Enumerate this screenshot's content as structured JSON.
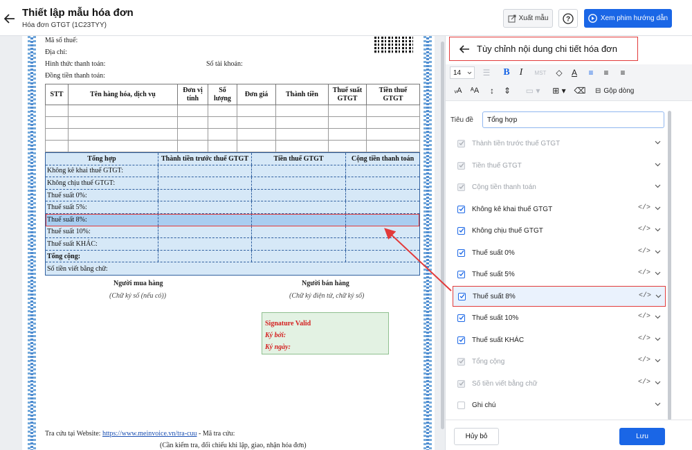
{
  "header": {
    "title": "Thiết lập mẫu hóa đơn",
    "subtitle": "Hóa đơn GTGT (1C23TYY)",
    "export_label": "Xuất mẫu",
    "video_label": "Xem phim hướng dẫn"
  },
  "invoice": {
    "tax_code_label": "Mã số thuế:",
    "address_label": "Địa chỉ:",
    "payment_label": "Hình thức thanh toán:",
    "account_label": "Số tài khoản:",
    "currency_label": "Đồng tiền thanh toán:",
    "columns": [
      "STT",
      "Tên hàng hóa, dịch vụ",
      "Đơn vị tính",
      "Số lượng",
      "Đơn giá",
      "Thành tiền",
      "Thuế suất GTGT",
      "Tiền thuế GTGT"
    ],
    "summary_headers": [
      "Tổng hợp",
      "Thành tiền trước thuế GTGT",
      "Tiền thuế GTGT",
      "Cộng tiền thanh toán"
    ],
    "summary_rows": [
      "Không kê khai thuế GTGT:",
      "Không chịu thuế GTGT:",
      "Thuế suất 0%:",
      "Thuế suất 5%:",
      "Thuế suất 8%:",
      "Thuế suất 10%:",
      "Thuế suất KHÁC:",
      "Tổng cộng:"
    ],
    "amount_words_label": "Số tiền viết bằng chữ:",
    "buyer_title": "Người mua hàng",
    "buyer_note": "(Chữ ký số (nếu có))",
    "seller_title": "Người bán hàng",
    "seller_note": "(Chữ ký điện tử, chữ ký số)",
    "signature_valid": "Signature Valid",
    "signed_by": "Ký bởi:",
    "signed_date": "Ký ngày:",
    "lookup_prefix": "Tra cứu tại Website:",
    "lookup_url": "https://www.meinvoice.vn/tra-cuu",
    "lookup_suffix": "- Mã tra cứu:",
    "bottom_note": "(Cần kiểm tra, đối chiếu khi lập, giao, nhận hóa đơn)"
  },
  "panel": {
    "title": "Tùy chỉnh nội dung chi tiết hóa đơn",
    "font_size": "14",
    "merge_label": "Gộp dòng",
    "title_field_label": "Tiêu đề",
    "title_field_value": "Tổng hợp",
    "rows": [
      {
        "label": "Thành tiền trước thuế GTGT",
        "state": "disabled",
        "code": false
      },
      {
        "label": "Tiền thuế GTGT",
        "state": "disabled",
        "code": false
      },
      {
        "label": "Cộng tiền thanh toán",
        "state": "disabled",
        "code": false
      },
      {
        "label": "Không kê khai thuế GTGT",
        "state": "checked",
        "code": true
      },
      {
        "label": "Không chịu thuế GTGT",
        "state": "checked",
        "code": true
      },
      {
        "label": "Thuế suất 0%",
        "state": "checked",
        "code": true
      },
      {
        "label": "Thuế suất 5%",
        "state": "checked",
        "code": true
      },
      {
        "label": "Thuế suất 8%",
        "state": "checked",
        "code": true
      },
      {
        "label": "Thuế suất 10%",
        "state": "checked",
        "code": true
      },
      {
        "label": "Thuế suất KHÁC",
        "state": "checked",
        "code": true
      },
      {
        "label": "Tổng cộng",
        "state": "disabled",
        "code": true
      },
      {
        "label": "Số tiền viết bằng chữ",
        "state": "disabled",
        "code": true
      },
      {
        "label": "Ghi chú",
        "state": "unchecked",
        "code": false
      }
    ],
    "cancel_label": "Hủy bỏ",
    "save_label": "Lưu"
  },
  "colors": {
    "accent": "#1a66e6",
    "highlight": "#e23a3a",
    "summary_bg": "#d6e8f7"
  }
}
